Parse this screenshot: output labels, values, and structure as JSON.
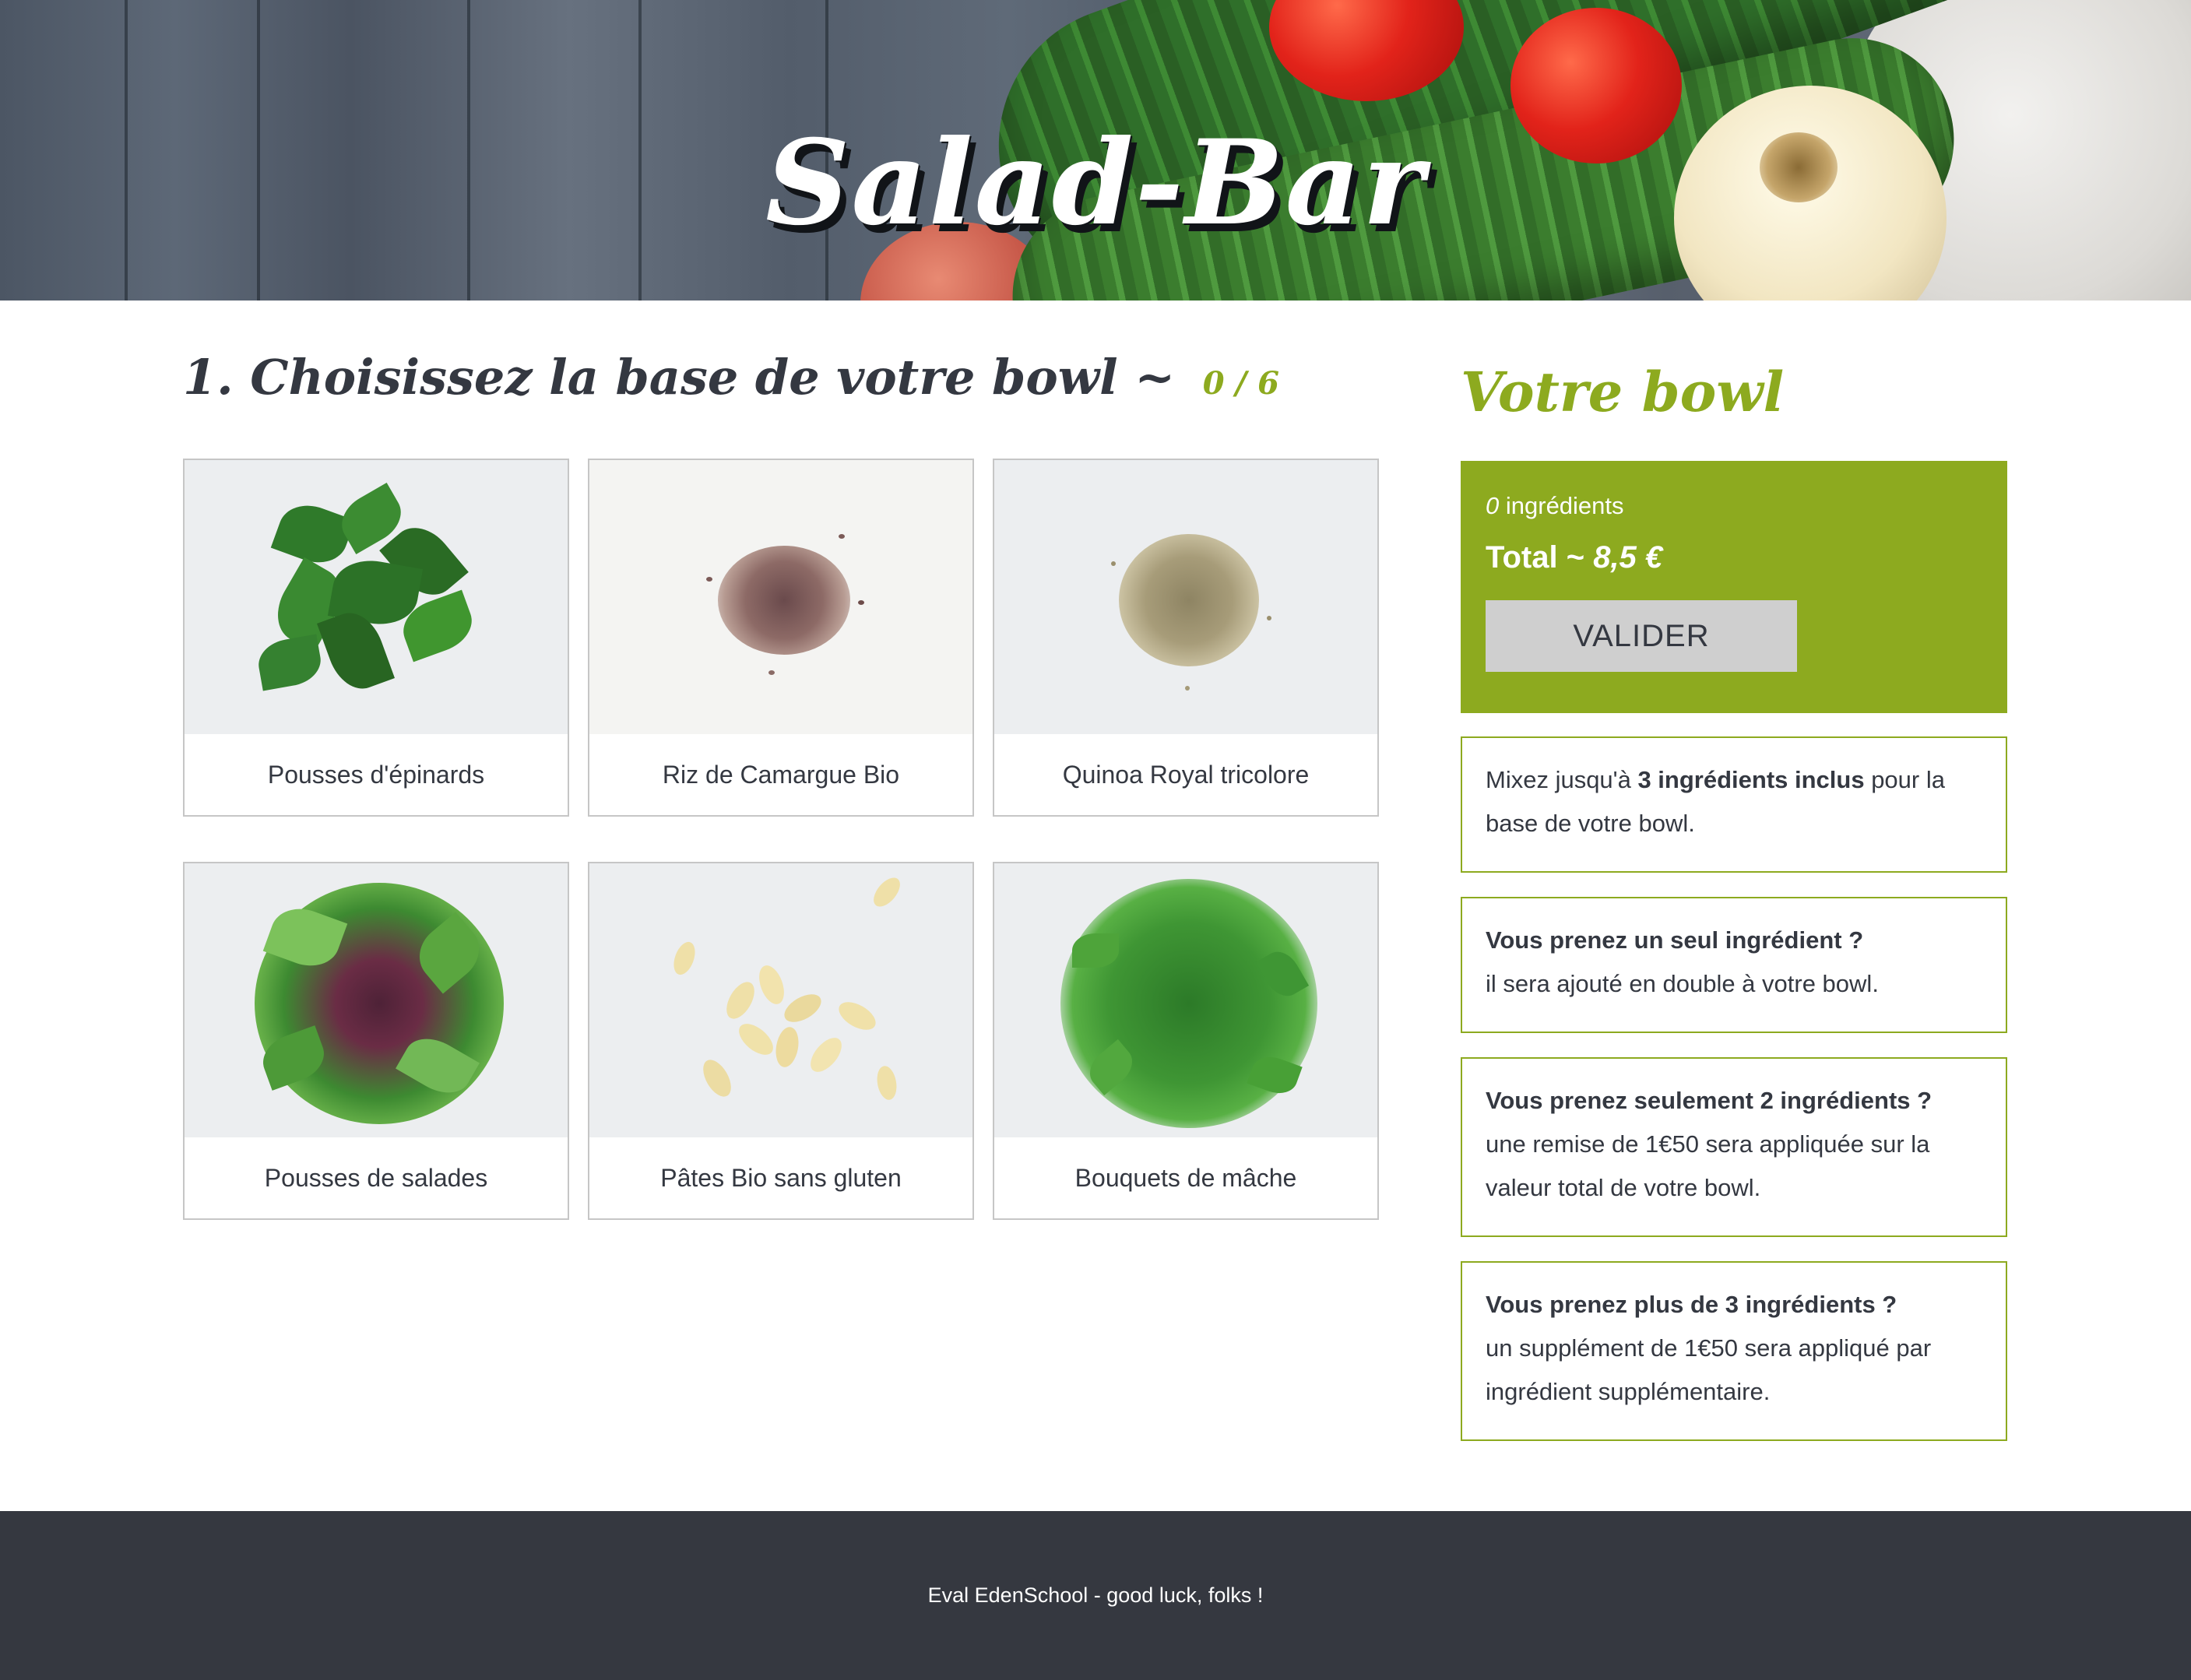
{
  "header": {
    "title": "Salad-Bar"
  },
  "step": {
    "title": "1. Choisissez la base de votre bowl ~",
    "counter": "0 / 6"
  },
  "products": [
    {
      "label": "Pousses d'épinards",
      "icon": "spinach-image"
    },
    {
      "label": "Riz de Camargue Bio",
      "icon": "rice-image"
    },
    {
      "label": "Quinoa Royal tricolore",
      "icon": "quinoa-image"
    },
    {
      "label": "Pousses de salades",
      "icon": "salad-image"
    },
    {
      "label": "Pâtes Bio sans gluten",
      "icon": "pasta-image"
    },
    {
      "label": "Bouquets de mâche",
      "icon": "mache-image"
    }
  ],
  "bowl": {
    "title": "Votre bowl",
    "ingredient_count": "0",
    "ingredients_label": "ingrédients",
    "total_label": "Total ~",
    "total_value": "8,5 €",
    "validate_label": "VALIDER",
    "accent_color": "#8daa1f"
  },
  "rules": [
    {
      "pre": "Mixez jusqu'à ",
      "bold": "3 ingrédients inclus",
      "post": " pour la base de votre bowl."
    },
    {
      "bold": "Vous prenez un seul ingrédient ?",
      "text": "il sera ajouté en double à votre bowl."
    },
    {
      "bold": "Vous prenez seulement 2 ingrédients ?",
      "text": "une remise de 1€50 sera appliquée sur la valeur total de votre bowl."
    },
    {
      "bold": "Vous prenez plus de 3 ingrédients ?",
      "text": "un supplément de 1€50 sera appliqué par ingrédient supplémentaire."
    }
  ],
  "footer": {
    "text": "Eval EdenSchool - good luck, folks !"
  }
}
